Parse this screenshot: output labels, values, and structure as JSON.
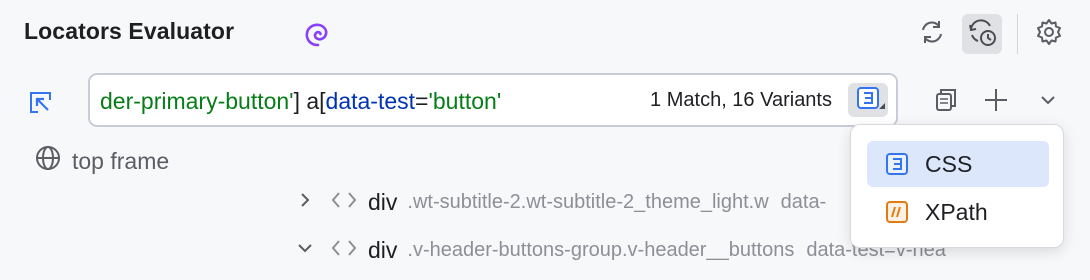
{
  "header": {
    "title": "Locators Evaluator"
  },
  "icons": {
    "ai": "ai-spiral-icon",
    "refresh": "refresh-icon",
    "history": "history-clock-icon",
    "settings": "gear-icon",
    "pick": "element-picker-icon",
    "copy": "copy-icon",
    "add": "plus-icon",
    "more": "chevron-down-icon",
    "frame": "globe-icon"
  },
  "colors": {
    "css": "#3574f0",
    "xpath": "#e07b16",
    "string": "#067d17",
    "attr": "#0033b3"
  },
  "locator_input": {
    "tokens": [
      {
        "text": "der-primary-button'",
        "kind": "green"
      },
      {
        "text": "] a[",
        "kind": "black"
      },
      {
        "text": "data-test",
        "kind": "blue"
      },
      {
        "text": "=",
        "kind": "black"
      },
      {
        "text": "'button'",
        "kind": "green"
      }
    ],
    "match_info": "1 Match, 16 Variants",
    "mode": "CSS"
  },
  "frame": {
    "label": "top frame"
  },
  "tree": {
    "rows": [
      {
        "arrow": "›",
        "tag": "div",
        "classes": ".wt-subtitle-2.wt-subtitle-2_theme_light.w",
        "attr": "data-"
      },
      {
        "arrow": "⌄",
        "tag": "div",
        "classes": ".v-header-buttons-group.v-header__buttons",
        "attr": "data-test=v-hea"
      }
    ]
  },
  "popup": {
    "items": [
      {
        "label": "CSS",
        "selected": true,
        "icon": "css-icon"
      },
      {
        "label": "XPath",
        "selected": false,
        "icon": "xpath-icon"
      }
    ]
  }
}
